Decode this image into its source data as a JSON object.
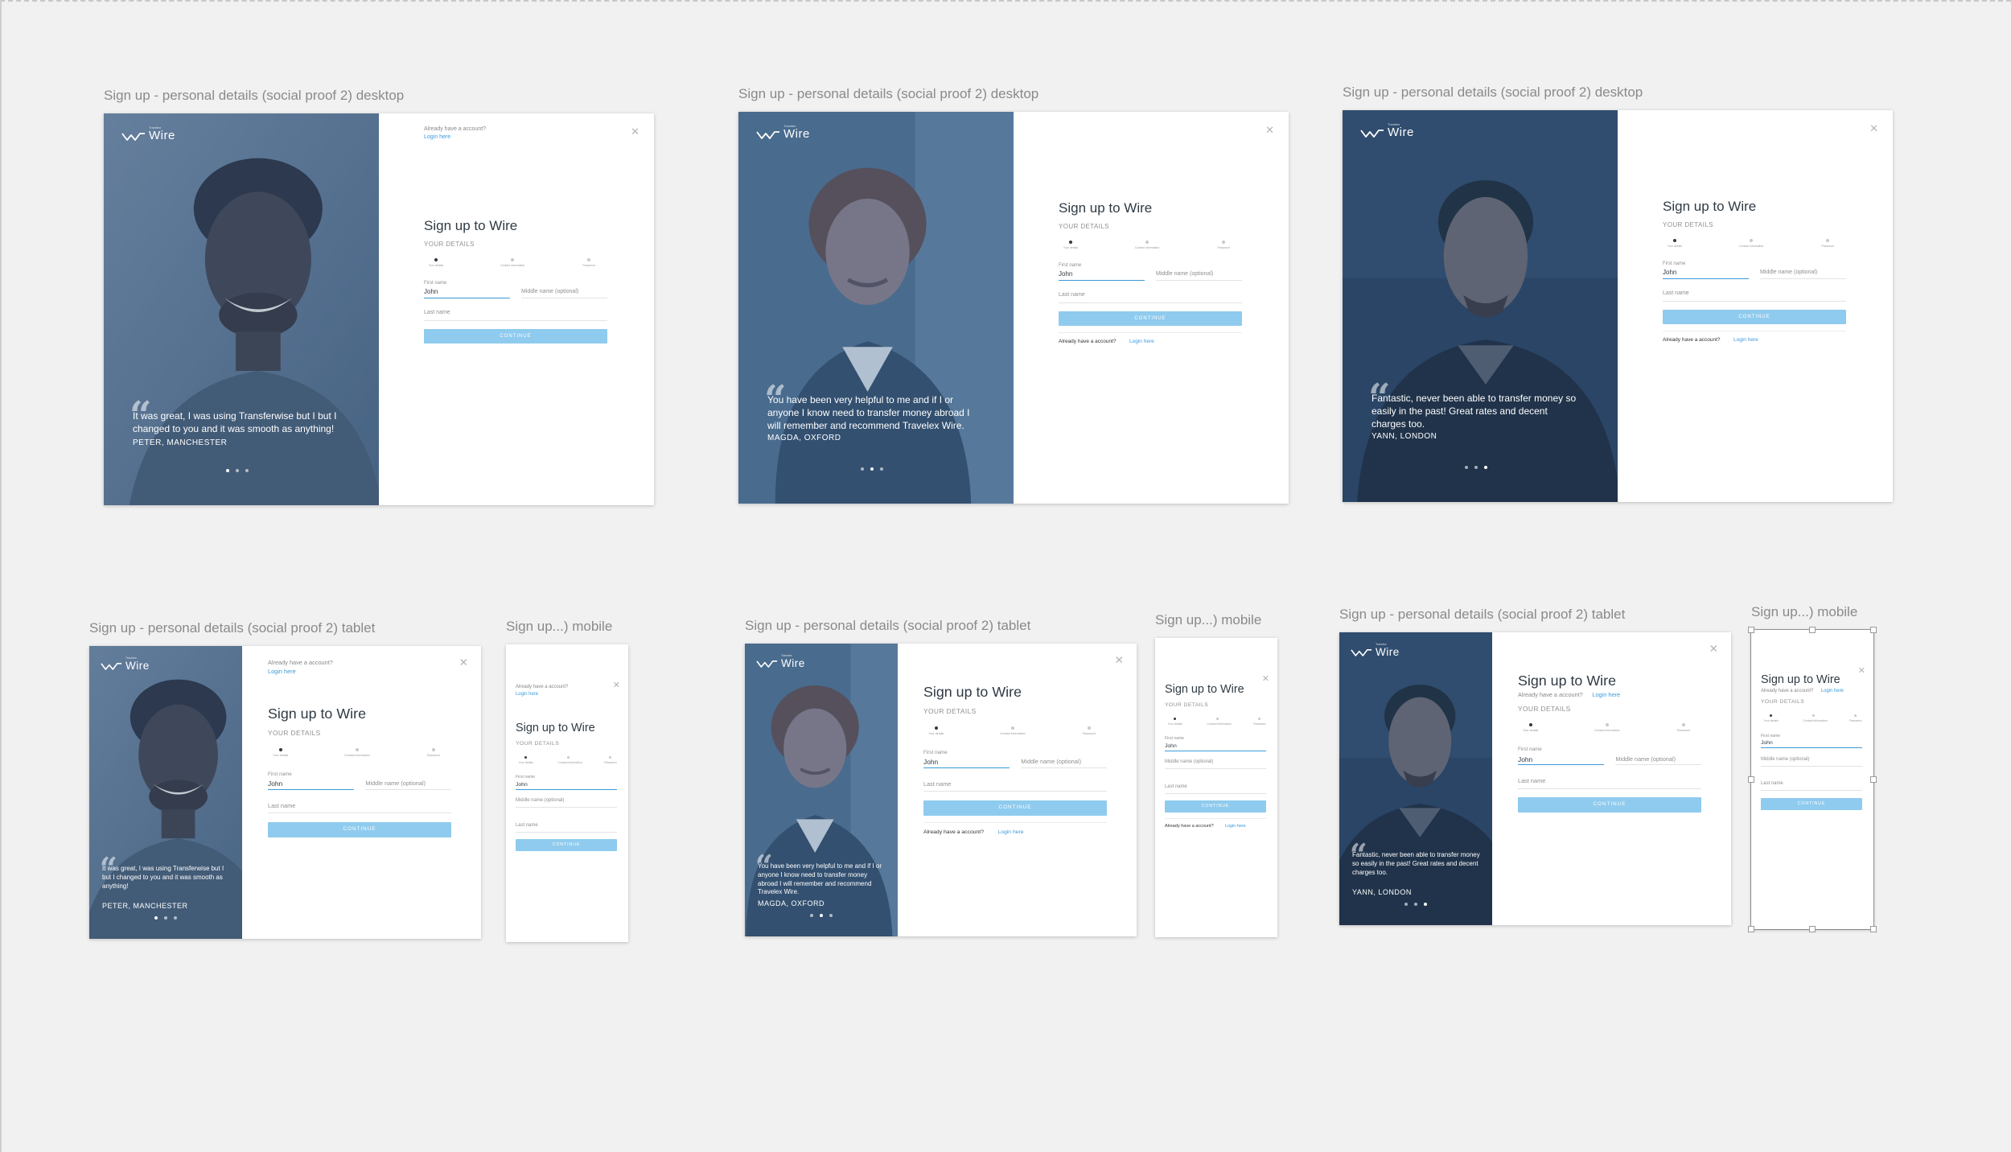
{
  "artboards": [
    {
      "label": "Sign up - personal details (social proof 2) desktop"
    },
    {
      "label": "Sign up - personal details (social proof 2) desktop"
    },
    {
      "label": "Sign up - personal details (social proof 2) desktop"
    },
    {
      "label": "Sign up - personal details (social proof 2) tablet"
    },
    {
      "label": "Sign up...) mobile"
    },
    {
      "label": "Sign up - personal details (social proof 2) tablet"
    },
    {
      "label": "Sign up...) mobile"
    },
    {
      "label": "Sign up - personal details (social proof 2) tablet"
    },
    {
      "label": "Sign up...) mobile"
    }
  ],
  "brand": {
    "name": "Wire",
    "sub": "Travelex"
  },
  "form": {
    "already": "Already have a account?",
    "login": "Login here",
    "title": "Sign up to Wire",
    "section": "YOUR DETAILS",
    "steps": [
      "Your details",
      "Contact information",
      "Password"
    ],
    "first_name_label": "First name",
    "first_name_value": "John",
    "middle_name": "Middle name (optional)",
    "last_name": "Last name",
    "continue": "CONTINUE"
  },
  "testimonials": [
    {
      "quote": "It was great, I was using Transferwise but I but I changed to you and it was smooth as anything!",
      "author": "PETER, MANCHESTER"
    },
    {
      "quote": "You have been very helpful to me and if I or anyone I know need to transfer money abroad I will remember and recommend Travelex Wire.",
      "author": "MAGDA, OXFORD"
    },
    {
      "quote": "Fantastic, never been able to transfer money so easily in the past! Great rates and decent charges too.",
      "author": "YANN, LONDON"
    }
  ],
  "colors": {
    "overlay_peter": "#4f6b8a",
    "overlay_magda": "#3f6387",
    "overlay_yann": "#2c4868",
    "accent": "#3a9ad9",
    "button": "#8fcbee"
  },
  "icons": {
    "logo": "wire-logo-icon",
    "close": "close-icon",
    "quote": "quote-mark-icon"
  }
}
